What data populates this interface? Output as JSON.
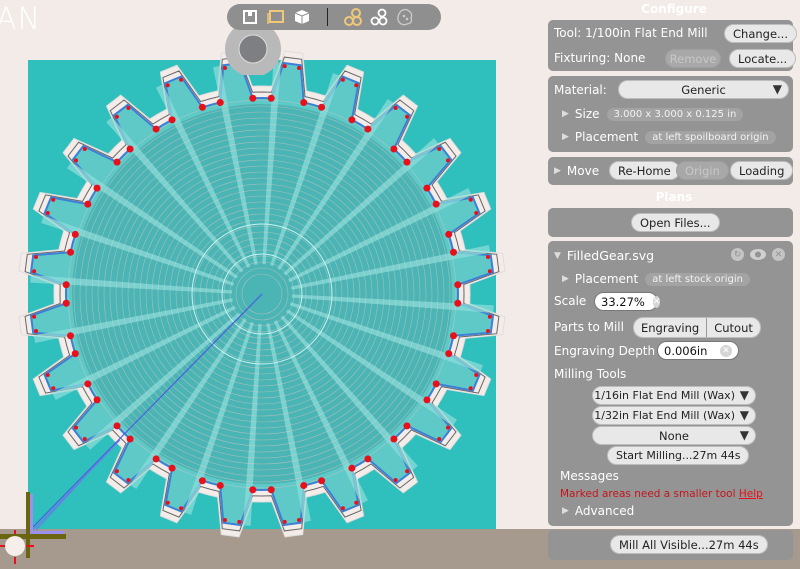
{
  "app": {
    "title_fragment": "AN"
  },
  "toolbar": {
    "icons": [
      {
        "name": "view-top-icon",
        "active": false
      },
      {
        "name": "view-front-icon",
        "active": true
      },
      {
        "name": "view-3d-icon",
        "active": false
      },
      {
        "name": "show-toolpaths-filled-icon",
        "active": true
      },
      {
        "name": "show-toolpaths-outline-icon",
        "active": false
      },
      {
        "name": "show-material-icon",
        "active": false
      }
    ]
  },
  "configure": {
    "heading": "Configure",
    "tool_label": "Tool: 1/100in Flat End Mill",
    "change_button": "Change...",
    "fixturing_label": "Fixturing: None",
    "remove_button": "Remove",
    "locate_button": "Locate...",
    "material_label": "Material:",
    "material_value": "Generic",
    "size_label": "Size",
    "size_value": "3.000 x 3.000 x 0.125 in",
    "placement_label": "Placement",
    "placement_value": "at left spoilboard origin",
    "move_label": "Move",
    "rehome_button": "Re-Home",
    "origin_button": "Origin",
    "loading_button": "Loading"
  },
  "plans": {
    "heading": "Plans",
    "open_files_button": "Open Files...",
    "file": {
      "name": "FilledGear.svg",
      "placement_label": "Placement",
      "placement_value": "at left stock origin",
      "scale_label": "Scale",
      "scale_value": "33.27%",
      "parts_label": "Parts to Mill",
      "parts": [
        "Engraving",
        "Cutout"
      ],
      "depth_label": "Engraving Depth",
      "depth_value": "0.006in",
      "milling_tools_label": "Milling Tools",
      "tools": [
        "1/16in Flat End Mill (Wax)",
        "1/32in Flat End Mill (Wax)",
        "None"
      ],
      "start_button": "Start Milling...27m 44s",
      "messages_label": "Messages",
      "message_text": "Marked areas need a smaller tool",
      "help_link": "Help",
      "advanced_label": "Advanced"
    },
    "mill_all_button": "Mill All Visible...27m 44s"
  },
  "colors": {
    "stock": "#2fbfbd",
    "floor": "#a59a8d",
    "panel": "#949494",
    "error": "#c4161c",
    "toolpath_outline": "#3b7fd6",
    "warning_marker": "#e8101a"
  },
  "gear": {
    "teeth": 24
  }
}
